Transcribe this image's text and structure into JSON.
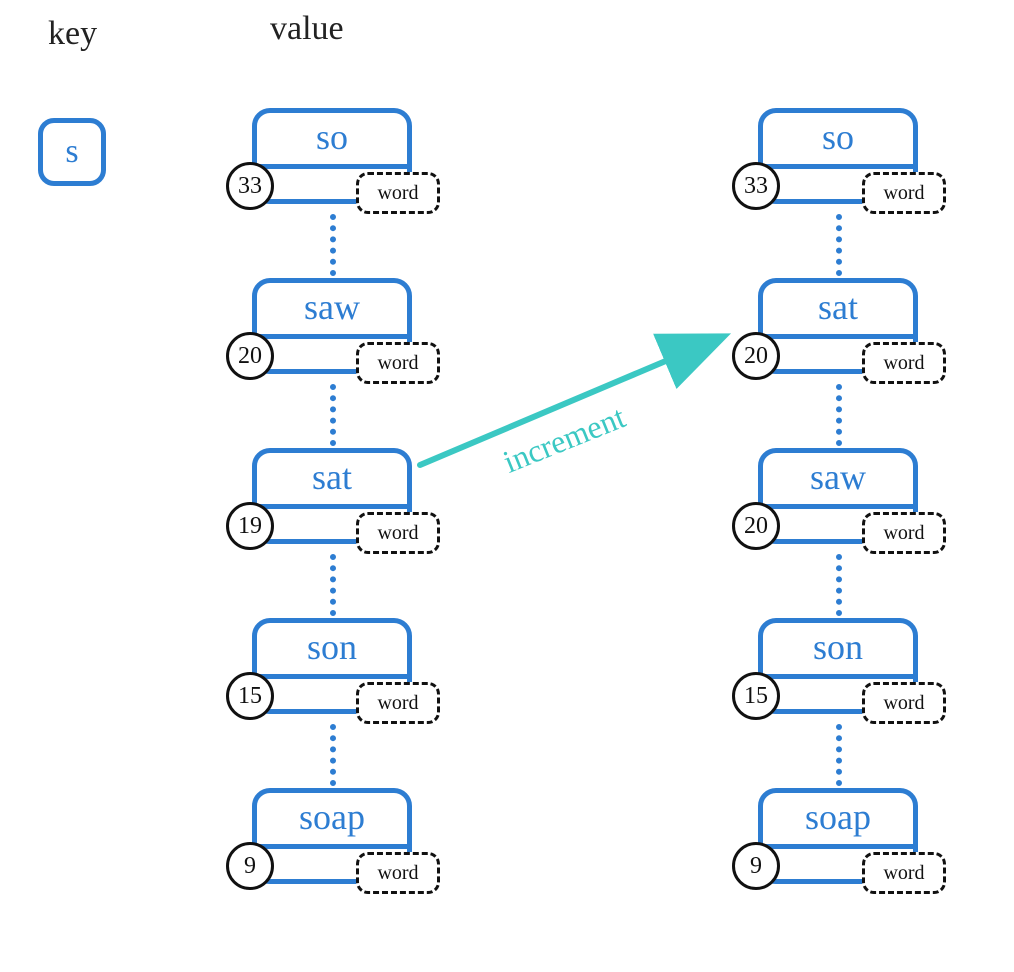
{
  "headers": {
    "key": "key",
    "value": "value"
  },
  "key_box": "s",
  "arrow_label": "increment",
  "word_badge": "word",
  "left_column": [
    {
      "text": "so",
      "count": "33"
    },
    {
      "text": "saw",
      "count": "20"
    },
    {
      "text": "sat",
      "count": "19"
    },
    {
      "text": "son",
      "count": "15"
    },
    {
      "text": "soap",
      "count": "9"
    }
  ],
  "right_column": [
    {
      "text": "so",
      "count": "33"
    },
    {
      "text": "sat",
      "count": "20"
    },
    {
      "text": "saw",
      "count": "20"
    },
    {
      "text": "son",
      "count": "15"
    },
    {
      "text": "soap",
      "count": "9"
    }
  ]
}
